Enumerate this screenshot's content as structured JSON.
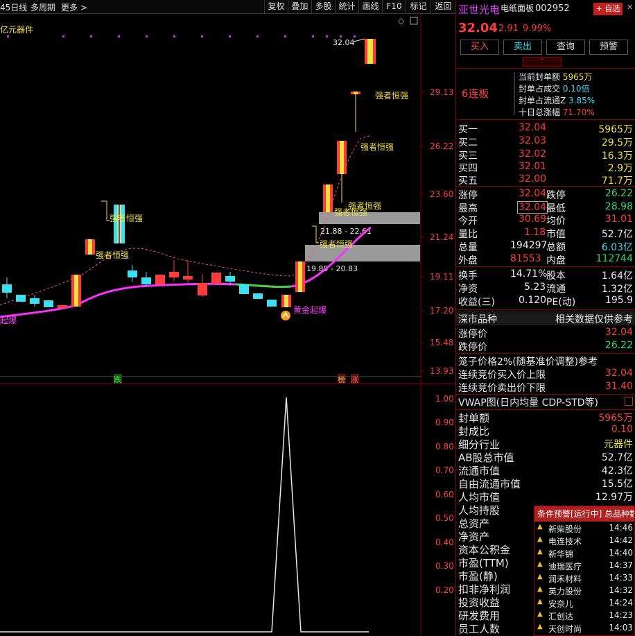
{
  "toolbar": {
    "period": "45日线",
    "multi_period": "多周期",
    "more": "更多",
    "buttons": [
      "复权",
      "叠加",
      "多股",
      "统计",
      "画线",
      "F10",
      "标记",
      "返回"
    ]
  },
  "chart": {
    "sector_prefix": "亿",
    "sector_label": "元器件",
    "top_price_label": "32.04",
    "price_axis": [
      "29.13",
      "26.22",
      "23.60",
      "21.24",
      "19.11",
      "17.20",
      "15.48",
      "13.93"
    ],
    "annotations": {
      "strong1": "强者恒强",
      "strong2": "强者恒强",
      "strong3": "强者恒强",
      "strong4": "强者恒强",
      "strong5": "强者恒强",
      "strong6": "强者恒强",
      "strong7": "强者恒强",
      "gold_burst": "黄金起爆",
      "left_burst": "起爆",
      "range_upper": "21.88 - 22.61",
      "range_lower": "19.89 - 20.83"
    },
    "bottom_tags": {
      "fall": "跌",
      "list": "榜",
      "rise": "涨"
    },
    "indicator_axis": [
      "1.00",
      "0.90",
      "0.80",
      "0.70",
      "0.60",
      "0.50",
      "0.40",
      "0.30",
      "0.20"
    ],
    "colors": {
      "up": "#ff3c3c",
      "down": "#3ce0f0",
      "ma": "#ff40ff",
      "limit_up": "#f0e040"
    }
  },
  "quote": {
    "name": "亚世光电",
    "sub_title": "电纸面板",
    "code": "002952",
    "add_watch": "+ 自选",
    "price": "32.04",
    "change": "2.91",
    "change_pct": "9.99%",
    "actions": [
      "买入",
      "卖出",
      "查询",
      "预警"
    ],
    "board_count": "6连板",
    "seal_info": [
      {
        "label": "当前封单额",
        "value": "5965万"
      },
      {
        "label": "封单占成交",
        "value": "0.10倍"
      },
      {
        "label": "封单占流通Z",
        "value": "3.85%"
      },
      {
        "label": "十日总涨幅",
        "value": "71.70%"
      }
    ],
    "order_book": [
      {
        "label": "买一",
        "price": "32.04",
        "vol": "5965万"
      },
      {
        "label": "买二",
        "price": "32.03",
        "vol": "29.5万"
      },
      {
        "label": "买三",
        "price": "32.02",
        "vol": "16.3万"
      },
      {
        "label": "买四",
        "price": "32.01",
        "vol": "2.9万"
      },
      {
        "label": "买五",
        "price": "32.00",
        "vol": "71.7万"
      }
    ],
    "stats": [
      {
        "l1": "涨停",
        "v1": "32.04",
        "l2": "跌停",
        "v2": "26.22",
        "c1": "red",
        "c2": "green"
      },
      {
        "l1": "最高",
        "v1": "32.04",
        "l2": "最低",
        "v2": "28.98",
        "c1": "red",
        "c2": "green"
      },
      {
        "l1": "今开",
        "v1": "30.69",
        "l2": "均价",
        "v2": "31.01",
        "c1": "red",
        "c2": "red"
      },
      {
        "l1": "量比",
        "v1": "1.18",
        "l2": "市值",
        "v2": "52.7亿",
        "c1": "red",
        "c2": "white"
      },
      {
        "l1": "总量",
        "v1": "194297",
        "l2": "总额",
        "v2": "6.03亿",
        "c1": "white",
        "c2": "cyan"
      },
      {
        "l1": "外盘",
        "v1": "81553",
        "l2": "内盘",
        "v2": "112744",
        "c1": "red",
        "c2": "green"
      }
    ],
    "stats2": [
      {
        "l1": "换手",
        "v1": "14.71%",
        "l2": "股本",
        "v2": "1.64亿"
      },
      {
        "l1": "净资",
        "v1": "5.23",
        "l2": "流通",
        "v2": "1.32亿"
      },
      {
        "l1": "收益(三)",
        "v1": "0.120",
        "l2": "PE(动)",
        "v2": "195.9"
      }
    ],
    "market_title": "深市品种",
    "market_note": "相关数据仅供参考",
    "limit_rows": [
      {
        "label": "涨停价",
        "value": "32.04",
        "color": "red"
      },
      {
        "label": "跌停价",
        "value": "26.22",
        "color": "green"
      }
    ],
    "cage_title": "笼子价格2%(随基准价调整)参考",
    "cage_rows": [
      {
        "label": "连续竞价买入价上限",
        "value": "32.04",
        "color": "red"
      },
      {
        "label": "连续竞价卖出价下限",
        "value": "31.40",
        "color": "red"
      }
    ],
    "vwap_title": "VWAP图(日内均量 CDP-STD等)",
    "fund_rows": [
      {
        "label": "封单额",
        "value": "5965万",
        "color": "red"
      },
      {
        "label": "封成比",
        "value": "0.10",
        "color": "red"
      },
      {
        "label": "细分行业",
        "value": "元器件",
        "color": "yellow"
      },
      {
        "label": "AB股总市值",
        "value": "52.7亿",
        "color": "white"
      },
      {
        "label": "流通市值",
        "value": "42.3亿",
        "color": "white"
      },
      {
        "label": "自由流通市值",
        "value": "15.5亿",
        "color": "white"
      },
      {
        "label": "人均市值",
        "value": "12.97万",
        "color": "white"
      },
      {
        "label": "人均持股",
        "value": "",
        "color": "white"
      },
      {
        "label": "总资产",
        "value": "",
        "color": "white"
      },
      {
        "label": "净资产",
        "value": "",
        "color": "white"
      },
      {
        "label": "资本公积金",
        "value": "",
        "color": "white"
      },
      {
        "label": "市盈(TTM)",
        "value": "",
        "color": "white"
      },
      {
        "label": "市盈(静)",
        "value": "",
        "color": "white"
      },
      {
        "label": "扣非净利润",
        "value": "",
        "color": "white"
      },
      {
        "label": "投资收益",
        "value": "",
        "color": "white"
      },
      {
        "label": "研发费用",
        "value": "",
        "color": "white"
      },
      {
        "label": "员工人数",
        "value": "",
        "color": "white"
      }
    ]
  },
  "alerts": {
    "header": "条件预警[运行中] 总品种数",
    "items": [
      {
        "name": "新柴股份",
        "time": "14:46"
      },
      {
        "name": "电连技术",
        "time": "14:42"
      },
      {
        "name": "新华锦",
        "time": "14:40"
      },
      {
        "name": "迪瑞医疗",
        "time": "14:37"
      },
      {
        "name": "润禾材料",
        "time": "14:33"
      },
      {
        "name": "英力股份",
        "time": "14:32"
      },
      {
        "name": "安奈儿",
        "time": "14:24"
      },
      {
        "name": "汇创达",
        "time": "14:23"
      },
      {
        "name": "天创时尚",
        "time": "14:03"
      }
    ]
  }
}
